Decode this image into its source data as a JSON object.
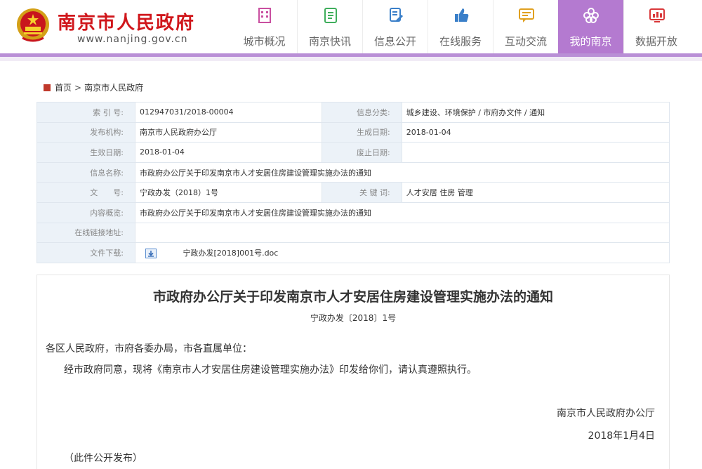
{
  "header": {
    "site_name": "南京市人民政府",
    "site_url": "www.nanjing.gov.cn",
    "colors": {
      "brand_red": "#d0161b",
      "accent_purple": "#b47ad0"
    }
  },
  "nav": [
    {
      "label": "城市概况",
      "icon": "building-icon",
      "color": "#c94fa0"
    },
    {
      "label": "南京快讯",
      "icon": "news-icon",
      "color": "#3fae5c"
    },
    {
      "label": "信息公开",
      "icon": "document-edit-icon",
      "color": "#3a7fc9"
    },
    {
      "label": "在线服务",
      "icon": "thumbs-up-icon",
      "color": "#3a7fc9"
    },
    {
      "label": "互动交流",
      "icon": "chat-icon",
      "color": "#e0a020"
    },
    {
      "label": "我的南京",
      "icon": "flower-icon",
      "color": "#ffffff",
      "active": true
    },
    {
      "label": "数据开放",
      "icon": "chart-monitor-icon",
      "color": "#d9383a"
    }
  ],
  "breadcrumb": {
    "home": "首页",
    "sep": ">",
    "current": "南京市人民政府"
  },
  "info": {
    "index_label": "索 引 号:",
    "index_value": "012947031/2018-00004",
    "category_label": "信息分类:",
    "category_value": "城乡建设、环境保护 / 市府办文件 / 通知",
    "issuer_label": "发布机构:",
    "issuer_value": "南京市人民政府办公厅",
    "created_label": "生成日期:",
    "created_value": "2018-01-04",
    "effective_label": "生效日期:",
    "effective_value": "2018-01-04",
    "expire_label": "废止日期:",
    "expire_value": "",
    "name_label": "信息名称:",
    "name_value": "市政府办公厅关于印发南京市人才安居住房建设管理实施办法的通知",
    "docno_label": "文　　号:",
    "docno_value": "宁政办发（2018）1号",
    "keywords_label": "关 键 词:",
    "keywords_value": "人才安居 住房 管理",
    "summary_label": "内容概览:",
    "summary_value": "市政府办公厅关于印发南京市人才安居住房建设管理实施办法的通知",
    "link_label": "在线链接地址:",
    "link_value": "",
    "download_label": "文件下载:",
    "download_value": "宁政办发[2018]001号.doc"
  },
  "article": {
    "title": "市政府办公厅关于印发南京市人才安居住房建设管理实施办法的通知",
    "doc_no": "宁政办发〔2018〕1号",
    "salutation": "各区人民政府，市府各委办局，市各直属单位：",
    "body": "经市政府同意，现将《南京市人才安居住房建设管理实施办法》印发给你们，请认真遵照执行。",
    "signature": "南京市人民政府办公厅",
    "date": "2018年1月4日",
    "note": "（此件公开发布）"
  }
}
